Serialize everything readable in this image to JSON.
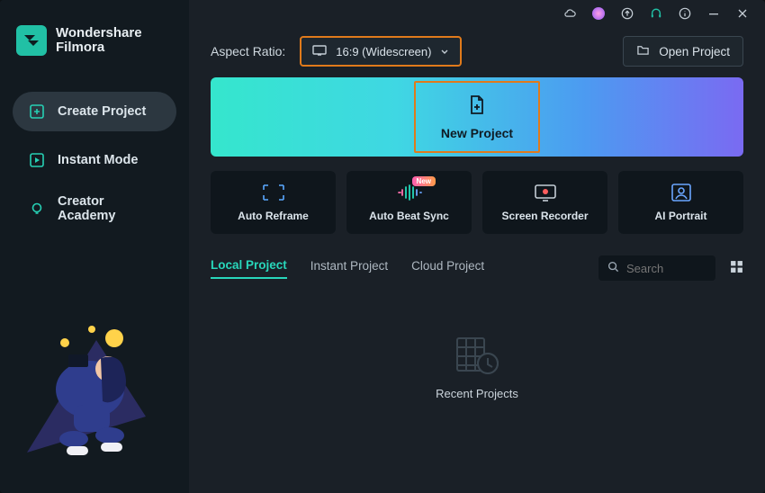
{
  "brand": {
    "line1": "Wondershare",
    "line2": "Filmora"
  },
  "sidebar": {
    "items": [
      {
        "label": "Create Project"
      },
      {
        "label": "Instant Mode"
      },
      {
        "label": "Creator Academy"
      }
    ]
  },
  "topbar": {
    "aspect_label": "Aspect Ratio:",
    "aspect_value": "16:9 (Widescreen)",
    "open_project": "Open Project"
  },
  "hero": {
    "title": "New Project"
  },
  "tools": [
    {
      "label": "Auto Reframe"
    },
    {
      "label": "Auto Beat Sync",
      "badge": "New"
    },
    {
      "label": "Screen Recorder"
    },
    {
      "label": "AI Portrait"
    }
  ],
  "tabs": [
    {
      "label": "Local Project",
      "active": true
    },
    {
      "label": "Instant Project"
    },
    {
      "label": "Cloud Project"
    }
  ],
  "search": {
    "placeholder": "Search"
  },
  "recent": {
    "label": "Recent Projects"
  }
}
